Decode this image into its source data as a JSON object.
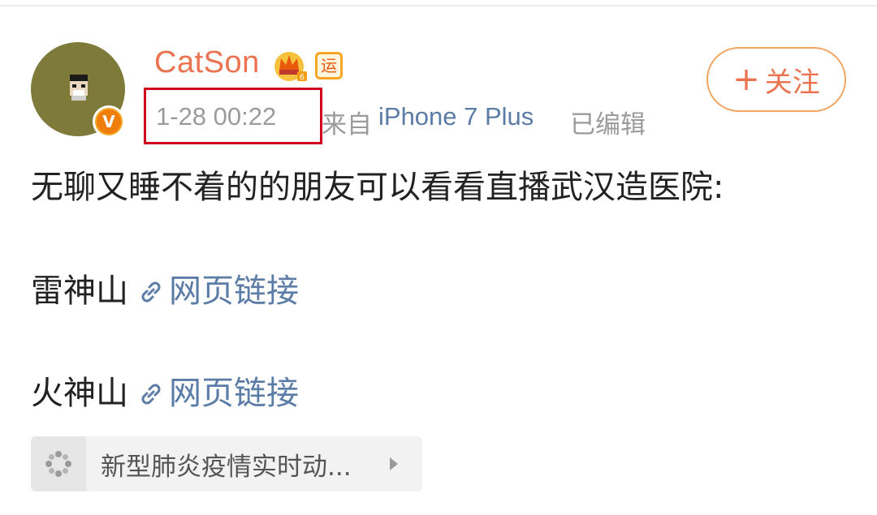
{
  "post": {
    "author": {
      "name": "CatSon",
      "verified_badge": "V",
      "membership_badge": "crown-icon",
      "extra_badge": "运"
    },
    "timestamp": "1-28 00:22",
    "source_prefix": "来自",
    "device": "iPhone 7 Plus",
    "edited_label": "已编辑",
    "follow_button": {
      "plus": "+",
      "label": "关注"
    },
    "text_line": "无聊又睡不着的的朋友可以看看直播武汉造医院:",
    "links": [
      {
        "name": "雷神山",
        "link_label": "网页链接"
      },
      {
        "name": "火神山",
        "link_label": "网页链接"
      }
    ],
    "topic_card": {
      "label": "新型肺炎疫情实时动..."
    }
  },
  "colors": {
    "username": "#eb7350",
    "link": "#5b7ca6",
    "meta": "#9b9b9b",
    "highlight_box": "#d0021b"
  }
}
